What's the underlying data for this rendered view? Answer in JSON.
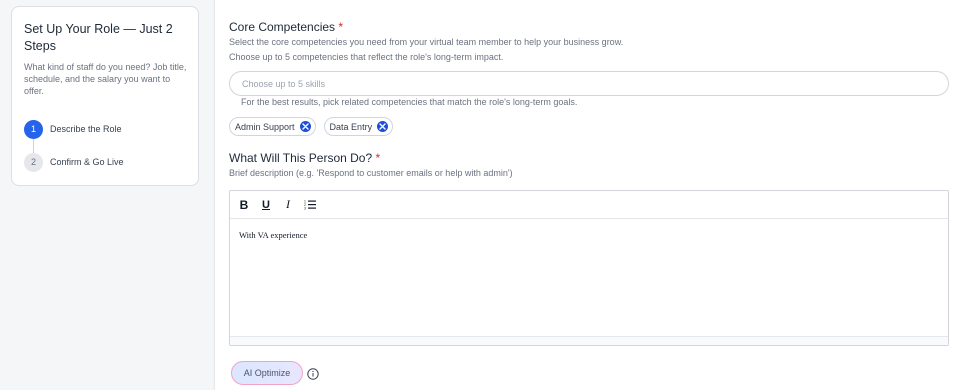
{
  "sidebar": {
    "title": "Set Up Your Role — Just 2 Steps",
    "description": "What kind of staff do you need? Job title, schedule, and the salary you want to offer.",
    "steps": [
      {
        "number": "1",
        "label": "Describe the Role",
        "active": true
      },
      {
        "number": "2",
        "label": "Confirm & Go Live",
        "active": false
      }
    ]
  },
  "competencies": {
    "title": "Core Competencies",
    "required_mark": "*",
    "hint1": "Select the core competencies you need from your virtual team member to help your business grow.",
    "hint2": "Choose up to 5 competencies that reflect the role's long-term impact.",
    "placeholder": "Choose up to 5 skills",
    "helper": "For the best results, pick related competencies that match the role's long-term goals.",
    "chips": [
      "Admin Support",
      "Data Entry"
    ]
  },
  "duties": {
    "title": "What Will This Person Do?",
    "required_mark": "*",
    "hint": "Brief description (e.g. 'Respond to customer emails or help with admin')",
    "toolbar": {
      "bold": "B",
      "underline": "U",
      "italic": "I"
    },
    "content": "With VA experience"
  },
  "actions": {
    "ai_optimize": "AI Optimize"
  },
  "colors": {
    "accent": "#2563eb",
    "required": "#dc2626"
  }
}
